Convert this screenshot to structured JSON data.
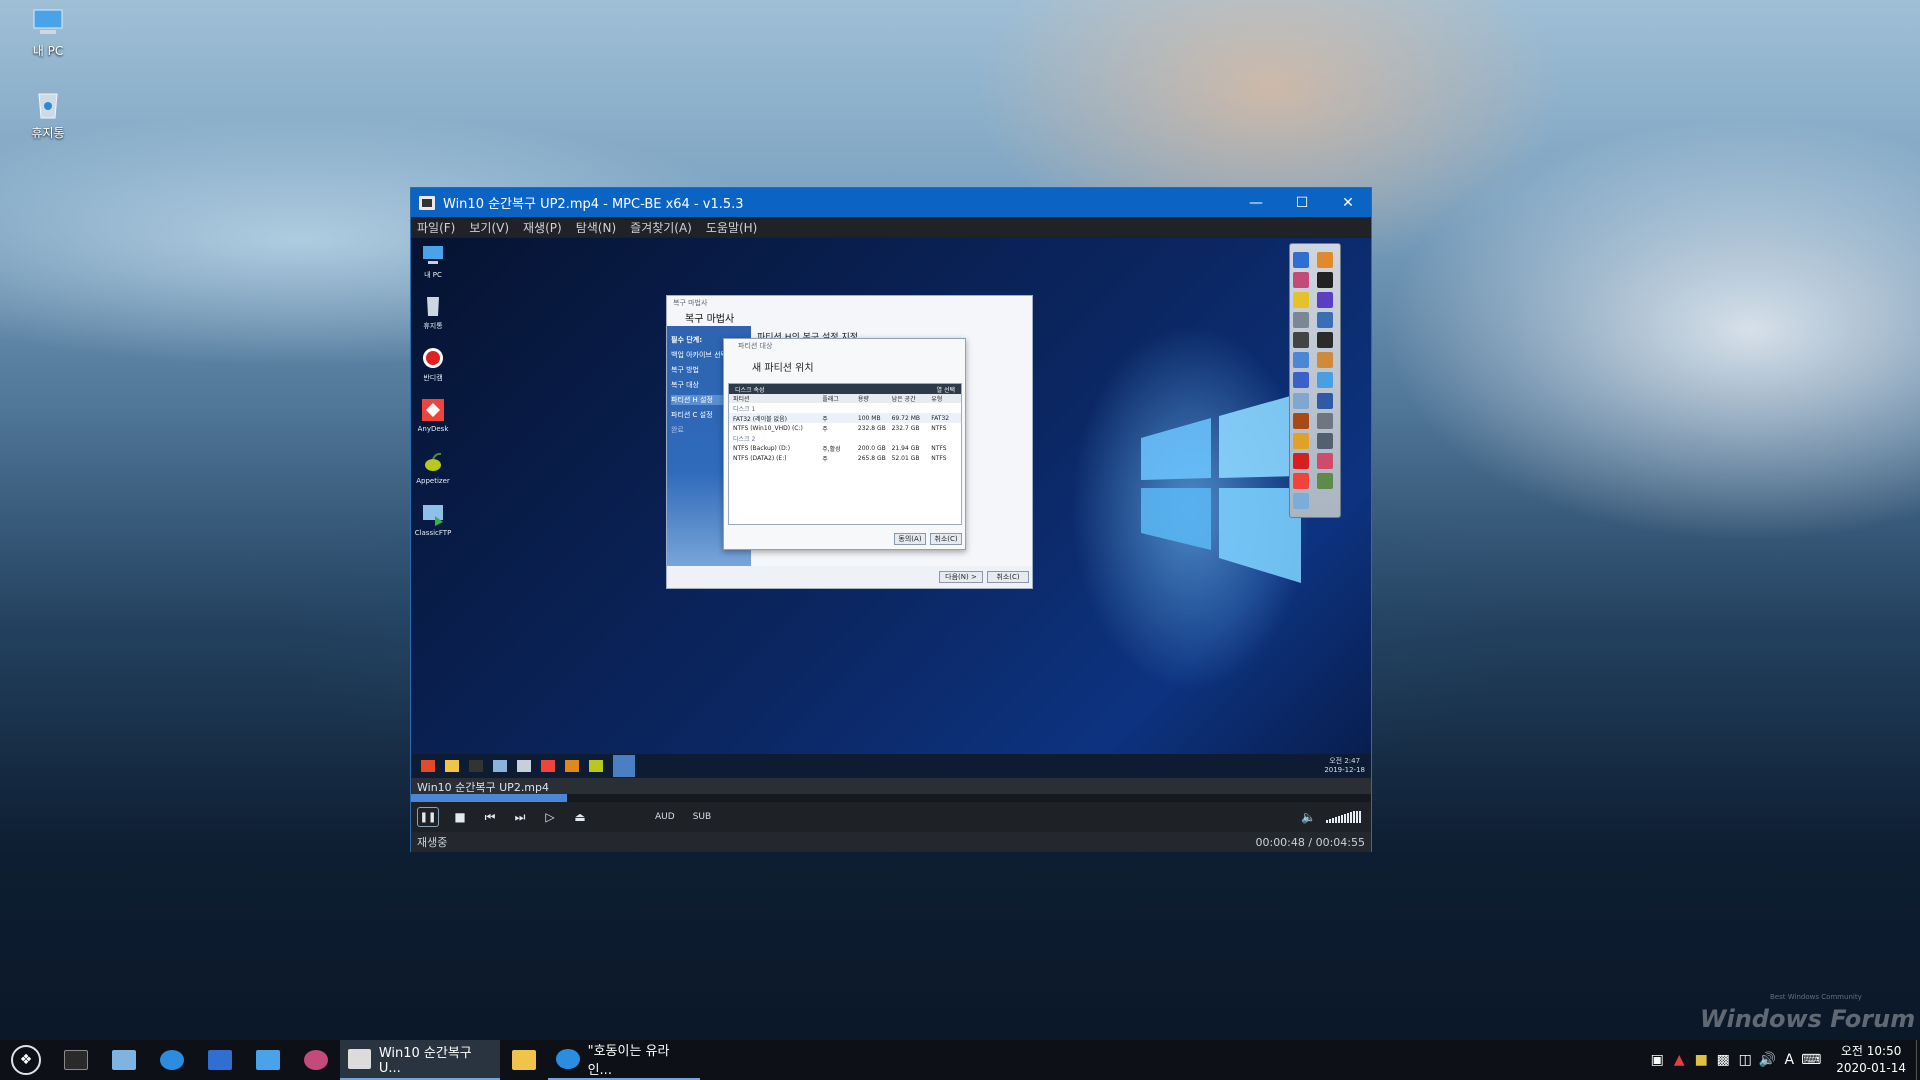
{
  "desktop": {
    "icons": [
      {
        "label": "내 PC"
      },
      {
        "label": "휴지통"
      }
    ],
    "watermark_main": "Windows Forum",
    "watermark_sub": "Best Windows Community"
  },
  "player": {
    "title": "Win10 순간복구 UP2.mp4 - MPC-BE x64 - v1.5.3",
    "menu": [
      "파일(F)",
      "보기(V)",
      "재생(P)",
      "탐색(N)",
      "즐겨찾기(A)",
      "도움말(H)"
    ],
    "tab_label": "Win10 순간복구 UP2.mp4",
    "aud_label": "AUD",
    "sub_label": "SUB",
    "status_text": "재생중",
    "time_text": "00:00:48 / 00:04:55",
    "progress": 0.163
  },
  "video": {
    "desktop_icons": [
      "내 PC",
      "휴지통",
      "반디캠",
      "AnyDesk",
      "Appetizer",
      "ClassicFTP"
    ],
    "clock_time": "오전 2:47",
    "clock_date": "2019-12-18",
    "wizard": {
      "small_title": "복구 마법사",
      "title": "복구 마법사",
      "side_header": "필수 단계:",
      "side_items": [
        "백업 아카이브 선택",
        "복구 방법",
        "복구 대상",
        "파티션 H 설정",
        "파티션 C 설정",
        "완료"
      ],
      "main_heading": "파티션 H의 복구 설정 지정",
      "next_button": "다음(N) >",
      "cancel_button": "취소(C)"
    },
    "dialog": {
      "small_title": "파티션 대상",
      "title": "새 파티션 위치",
      "bar_left": "디스크 속성",
      "bar_right": "열 선택",
      "columns": [
        "파티션",
        "플래그",
        "용량",
        "남은 공간",
        "유형"
      ],
      "disk1": "디스크 1",
      "disk2": "디스크 2",
      "rows1": [
        [
          "FAT32 (레이블 없음)",
          "주",
          "100 MB",
          "69.72 MB",
          "FAT32"
        ],
        [
          "NTFS (Win10_VHD) (C:)",
          "주",
          "232.8 GB",
          "232.7 GB",
          "NTFS"
        ]
      ],
      "rows2": [
        [
          "NTFS (Backup) (D:)",
          "주,활성",
          "200.0 GB",
          "21.94 GB",
          "NTFS"
        ],
        [
          "NTFS (DATA2) (E:)",
          "주",
          "265.8 GB",
          "52.01 GB",
          "NTFS"
        ]
      ],
      "ok_button": "동의(A)",
      "cancel_button": "취소(C)"
    }
  },
  "taskbar": {
    "tasks": [
      {
        "label": "Win10 순간복구 U..."
      },
      {
        "label": "\"호동이는 유라인..."
      }
    ],
    "ime": "A",
    "clock_time": "오전 10:50",
    "clock_date": "2020-01-14"
  }
}
